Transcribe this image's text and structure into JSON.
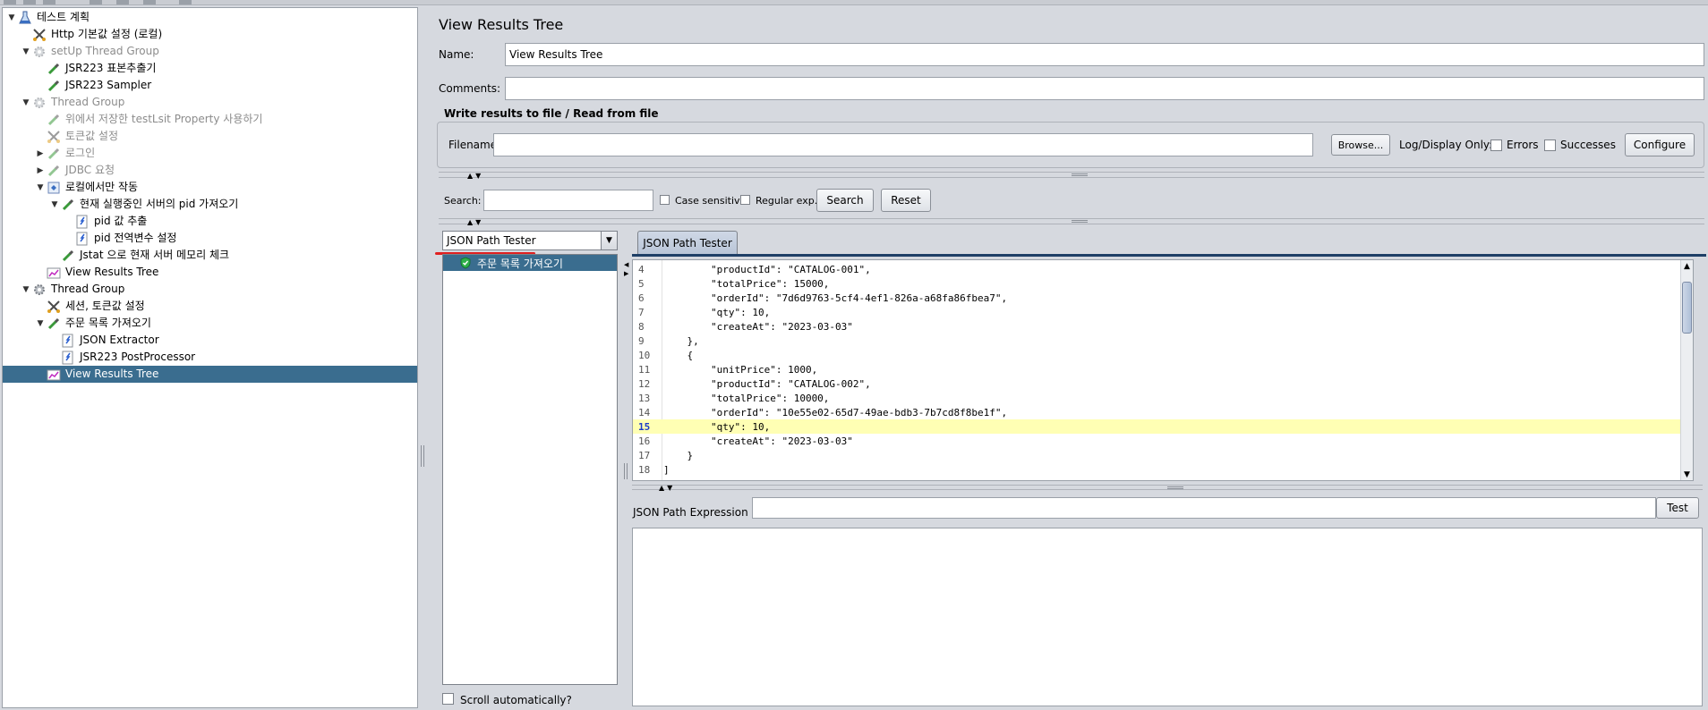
{
  "tree": {
    "items": [
      {
        "label": "테스트 계획",
        "icon": "test-plan-icon",
        "toggle": "down",
        "depth": 0,
        "disabled": false,
        "selected": false
      },
      {
        "label": "Http 기본값 설정 (로컬)",
        "icon": "config-scissors-icon",
        "toggle": "",
        "depth": 1,
        "disabled": false,
        "selected": false
      },
      {
        "label": "setUp Thread Group",
        "icon": "thread-group-gear-icon",
        "toggle": "down",
        "depth": 1,
        "disabled": true,
        "selected": false
      },
      {
        "label": "JSR223 표본추출기",
        "icon": "sampler-pipette-icon",
        "toggle": "",
        "depth": 2,
        "disabled": false,
        "selected": false
      },
      {
        "label": "JSR223 Sampler",
        "icon": "sampler-pipette-icon",
        "toggle": "",
        "depth": 2,
        "disabled": false,
        "selected": false
      },
      {
        "label": "Thread Group",
        "icon": "thread-group-gear-icon",
        "toggle": "down",
        "depth": 1,
        "disabled": true,
        "selected": false
      },
      {
        "label": "위에서 저장한 testLsit Property 사용하기",
        "icon": "sampler-pipette-icon",
        "toggle": "",
        "depth": 2,
        "disabled": true,
        "selected": false
      },
      {
        "label": "토큰값 설정",
        "icon": "config-scissors-icon",
        "toggle": "",
        "depth": 2,
        "disabled": true,
        "selected": false
      },
      {
        "label": "로그인",
        "icon": "sampler-pipette-icon",
        "toggle": "right",
        "depth": 2,
        "disabled": true,
        "selected": false
      },
      {
        "label": "JDBC 요청",
        "icon": "sampler-pipette-icon",
        "toggle": "right",
        "depth": 2,
        "disabled": true,
        "selected": false
      },
      {
        "label": "로컬에서만 작동",
        "icon": "if-controller-icon",
        "toggle": "down",
        "depth": 2,
        "disabled": false,
        "selected": false
      },
      {
        "label": "현재 실행중인 서버의 pid 가져오기",
        "icon": "sampler-pipette-icon",
        "toggle": "down",
        "depth": 3,
        "disabled": false,
        "selected": false
      },
      {
        "label": "pid 값 추출",
        "icon": "post-processor-icon",
        "toggle": "",
        "depth": 4,
        "disabled": false,
        "selected": false
      },
      {
        "label": "pid 전역변수 설정",
        "icon": "post-processor-icon",
        "toggle": "",
        "depth": 4,
        "disabled": false,
        "selected": false
      },
      {
        "label": "Jstat 으로 현재 서버 메모리 체크",
        "icon": "sampler-pipette-icon",
        "toggle": "",
        "depth": 3,
        "disabled": false,
        "selected": false
      },
      {
        "label": "View Results Tree",
        "icon": "listener-graph-icon",
        "toggle": "",
        "depth": 2,
        "disabled": false,
        "selected": false
      },
      {
        "label": "Thread Group",
        "icon": "thread-group-gear-icon",
        "toggle": "down",
        "depth": 1,
        "disabled": false,
        "selected": false
      },
      {
        "label": "세션, 토큰값 설정",
        "icon": "config-scissors-icon",
        "toggle": "",
        "depth": 2,
        "disabled": false,
        "selected": false
      },
      {
        "label": "주문 목록 가져오기",
        "icon": "sampler-pipette-icon",
        "toggle": "down",
        "depth": 2,
        "disabled": false,
        "selected": false
      },
      {
        "label": "JSON Extractor",
        "icon": "post-processor-icon",
        "toggle": "",
        "depth": 3,
        "disabled": false,
        "selected": false
      },
      {
        "label": "JSR223 PostProcessor",
        "icon": "post-processor-icon",
        "toggle": "",
        "depth": 3,
        "disabled": false,
        "selected": false
      },
      {
        "label": "View Results Tree",
        "icon": "listener-graph-icon",
        "toggle": "",
        "depth": 2,
        "disabled": false,
        "selected": true
      }
    ]
  },
  "panel": {
    "title": "View Results Tree",
    "name_label": "Name:",
    "name_value": "View Results Tree",
    "comments_label": "Comments:",
    "comments_value": "",
    "file_section_title": "Write results to file / Read from file",
    "filename_label": "Filename",
    "filename_value": "",
    "browse_label": "Browse...",
    "log_display_label": "Log/Display Only:",
    "errors_label": "Errors",
    "successes_label": "Successes",
    "configure_label": "Configure"
  },
  "search": {
    "label": "Search:",
    "value": "",
    "case_sensitive_label": "Case sensitive",
    "regex_label": "Regular exp.",
    "search_button": "Search",
    "reset_button": "Reset"
  },
  "results": {
    "renderer_selected": "JSON Path Tester",
    "items": [
      {
        "label": "주문 목록 가져오기",
        "status": "success"
      }
    ],
    "scroll_auto_label": "Scroll automatically?"
  },
  "tester": {
    "tab_label": "JSON Path Tester",
    "code_lines": [
      {
        "n": "4",
        "text": "        \"productId\": \"CATALOG-001\",",
        "highlight": false
      },
      {
        "n": "5",
        "text": "        \"totalPrice\": 15000,",
        "highlight": false
      },
      {
        "n": "6",
        "text": "        \"orderId\": \"7d6d9763-5cf4-4ef1-826a-a68fa86fbea7\",",
        "highlight": false
      },
      {
        "n": "7",
        "text": "        \"qty\": 10,",
        "highlight": false
      },
      {
        "n": "8",
        "text": "        \"createAt\": \"2023-03-03\"",
        "highlight": false
      },
      {
        "n": "9",
        "text": "    },",
        "highlight": false
      },
      {
        "n": "10",
        "text": "    {",
        "highlight": false
      },
      {
        "n": "11",
        "text": "        \"unitPrice\": 1000,",
        "highlight": false
      },
      {
        "n": "12",
        "text": "        \"productId\": \"CATALOG-002\",",
        "highlight": false
      },
      {
        "n": "13",
        "text": "        \"totalPrice\": 10000,",
        "highlight": false
      },
      {
        "n": "14",
        "text": "        \"orderId\": \"10e55e02-65d7-49ae-bdb3-7b7cd8f8be1f\",",
        "highlight": false
      },
      {
        "n": "15",
        "text": "        \"qty\": 10,",
        "highlight": true
      },
      {
        "n": "16",
        "text": "        \"createAt\": \"2023-03-03\"",
        "highlight": false
      },
      {
        "n": "17",
        "text": "    }",
        "highlight": false
      },
      {
        "n": "18",
        "text": "]",
        "highlight": false
      }
    ],
    "expression_label": "JSON Path Expression",
    "expression_value": "",
    "test_button": "Test",
    "output_value": ""
  },
  "colors": {
    "selection": "#3a6d8f",
    "highlight_line": "#ffffb4",
    "panel_bg": "#d6d9df",
    "accent_underline": "#e02020"
  }
}
